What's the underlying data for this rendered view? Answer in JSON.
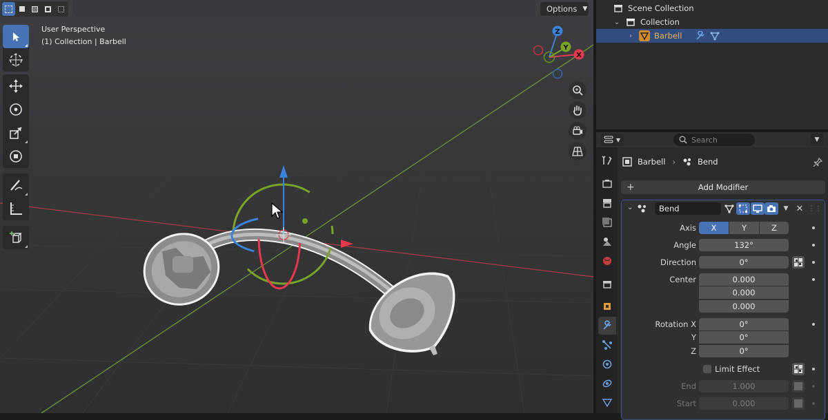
{
  "viewport": {
    "info_line1": "User Perspective",
    "info_line2": "(1) Collection | Barbell",
    "options_label": "Options",
    "select_modes": [
      "select-box-icon",
      "select-extend-icon",
      "select-subtract-icon",
      "select-difference-icon",
      "select-intersect-icon"
    ],
    "tools": [
      "select-box-icon",
      "cursor-icon",
      "move-icon",
      "rotate-icon",
      "scale-icon",
      "transform-icon",
      "annotate-icon",
      "measure-icon",
      "add-cube-icon"
    ],
    "gizmo_axes": {
      "z": "Z",
      "y": "Y",
      "x": "X"
    },
    "nav_buttons": [
      "zoom-icon",
      "hand-pan-icon",
      "camera-icon",
      "perspective-grid-icon"
    ],
    "colors": {
      "x_axis": "#e8394e",
      "y_axis": "#7ba32a",
      "z_axis": "#3b83d8",
      "accent": "#4772b3"
    }
  },
  "outliner": {
    "scene_collection": "Scene Collection",
    "collection": "Collection",
    "object": "Barbell"
  },
  "properties": {
    "search_placeholder": "Search",
    "breadcrumb_object": "Barbell",
    "breadcrumb_modifier": "Bend",
    "add_modifier": "Add Modifier",
    "modifier": {
      "name": "Bend",
      "axis_label": "Axis",
      "axis_options": [
        "X",
        "Y",
        "Z"
      ],
      "axis_selected": "X",
      "angle_label": "Angle",
      "angle": "132°",
      "direction_label": "Direction",
      "direction": "0°",
      "center_label": "Center",
      "center": [
        "0.000",
        "0.000",
        "0.000"
      ],
      "rotation_label_x": "Rotation X",
      "rotation_label_y": "Y",
      "rotation_label_z": "Z",
      "rotation": [
        "0°",
        "0°",
        "0°"
      ],
      "limit_effect_label": "Limit Effect",
      "end_label": "End",
      "end": "1.000",
      "start_label": "Start",
      "start": "0.000"
    }
  }
}
